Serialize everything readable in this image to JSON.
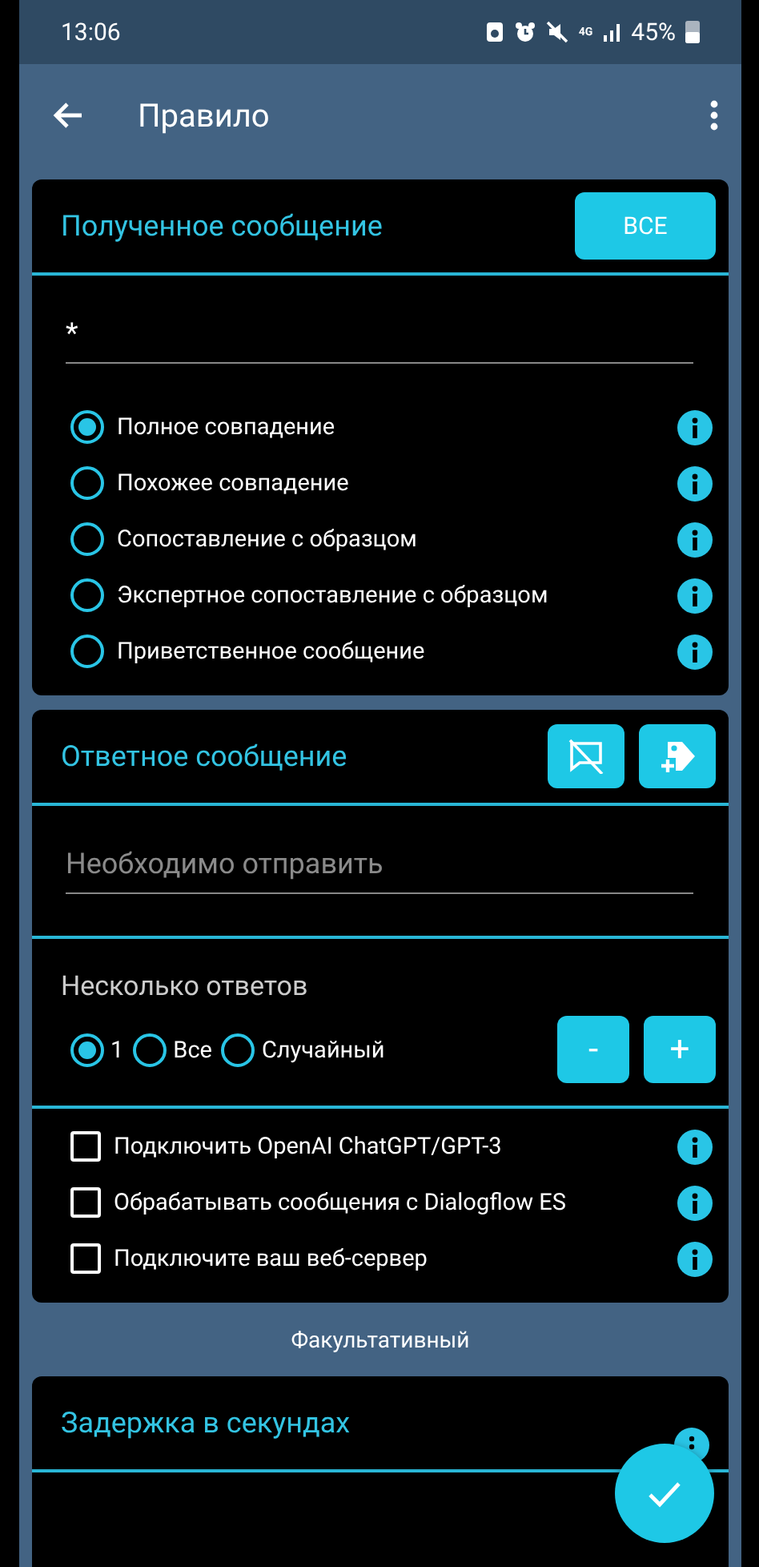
{
  "status_bar": {
    "time": "13:06",
    "network": "4G",
    "battery": "45%"
  },
  "app_bar": {
    "title": "Правило"
  },
  "received": {
    "title": "Полученное сообщение",
    "all_button": "ВСЕ",
    "value": "*",
    "match_options": [
      {
        "label": "Полное совпадение",
        "selected": true
      },
      {
        "label": "Похожее совпадение",
        "selected": false
      },
      {
        "label": "Сопоставление с образцом",
        "selected": false
      },
      {
        "label": "Экспертное сопоставление с образцом",
        "selected": false
      },
      {
        "label": "Приветственное сообщение",
        "selected": false
      }
    ]
  },
  "reply": {
    "title": "Ответное сообщение",
    "placeholder": "Необходимо отправить",
    "multi_label": "Несколько ответов",
    "count_options": [
      {
        "label": "1",
        "selected": true
      },
      {
        "label": "Все",
        "selected": false
      },
      {
        "label": "Случайный",
        "selected": false
      }
    ],
    "minus": "-",
    "plus": "+",
    "integrations": [
      {
        "label": "Подключить OpenAI ChatGPT/GPT-3",
        "checked": false
      },
      {
        "label": "Обрабатывать сообщения с Dialogflow ES",
        "checked": false
      },
      {
        "label": "Подключите ваш веб-сервер",
        "checked": false
      }
    ]
  },
  "optional_label": "Факультативный",
  "delay": {
    "title": "Задержка в секундах"
  }
}
